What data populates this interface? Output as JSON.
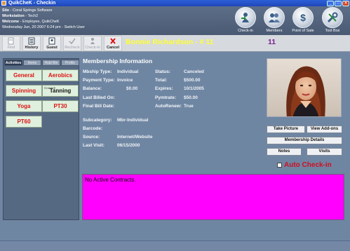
{
  "window": {
    "title": "QuikCheK - Checkin"
  },
  "header_info": {
    "site_label": "Site",
    "site_value": "Coral Springs Software",
    "workstation_label": "Workstation",
    "workstation_value": "Tech2",
    "welcome_label": "Welcome",
    "welcome_value": "Employee, QuikCheK",
    "datetime": "Wednesday Jun, 20 2007 6:24 pm",
    "switch_user": "Switch User"
  },
  "nav_buttons": [
    "Check-in",
    "Members",
    "Point of Sale",
    "Tool Box"
  ],
  "toolbar": {
    "buttons": [
      {
        "label": "Find",
        "enabled": false
      },
      {
        "label": "History",
        "enabled": true
      },
      {
        "label": "Guest",
        "enabled": true
      },
      {
        "label": "Recheck",
        "enabled": false
      },
      {
        "label": "Check-in",
        "enabled": false
      },
      {
        "label": "Cancel",
        "enabled": true
      }
    ],
    "member_name": "Bonnie Richardson - # 11",
    "member_id": "11"
  },
  "left_panel": {
    "tabs": [
      "Activities",
      "Items",
      "Hold Bin",
      "Profile"
    ],
    "active_tab": "Activities",
    "activities": [
      {
        "label": "General",
        "color": "red"
      },
      {
        "label": "Aerobics",
        "color": "red"
      },
      {
        "label": "Spinning",
        "color": "red"
      },
      {
        "label": "Tanning",
        "color": "black",
        "count": "Count 9"
      },
      {
        "label": "Yoga",
        "color": "red"
      },
      {
        "label": "PT30",
        "color": "red"
      },
      {
        "label": "PT60",
        "color": "red"
      }
    ]
  },
  "membership": {
    "title": "Membership Information",
    "left": [
      {
        "label": "Mbship Type:",
        "value": "Individual"
      },
      {
        "label": "Payment Type:",
        "value": "Invoice"
      },
      {
        "label": "Balance:",
        "value": "$0.00"
      },
      {
        "label": "Last Billed On:",
        "value": ""
      },
      {
        "label": "Final Bill Date:",
        "value": ""
      }
    ],
    "right": [
      {
        "label": "Status:",
        "value": "Canceled"
      },
      {
        "label": "Total:",
        "value": "$500.00"
      },
      {
        "label": "Expires:",
        "value": "10/1/2005"
      },
      {
        "label": "Pymtrate:",
        "value": "$50.00"
      },
      {
        "label": "AutoRenew:",
        "value": "True"
      }
    ],
    "lower": [
      {
        "label": "Subcategory:",
        "value": "Mbr-Individual"
      },
      {
        "label": "Barcode:",
        "value": ""
      },
      {
        "label": "Source:",
        "value": "Internet/Website"
      },
      {
        "label": "Last Visit:",
        "value": "06/15/2000"
      }
    ]
  },
  "right_buttons": {
    "take_picture": "Take Picture",
    "view_addons": "View Add-ons",
    "membership_details": "Membership Details",
    "notes": "Notes",
    "visits": "Visits"
  },
  "auto_checkin": {
    "label": "Auto Check-in",
    "checked": false
  },
  "contracts": {
    "text": "No Active Contracts."
  },
  "colors": {
    "name": "#ffff33",
    "id": "#7a1f8f",
    "auto_checkin": "#cc1122",
    "contracts_bg": "#ff00ff"
  }
}
